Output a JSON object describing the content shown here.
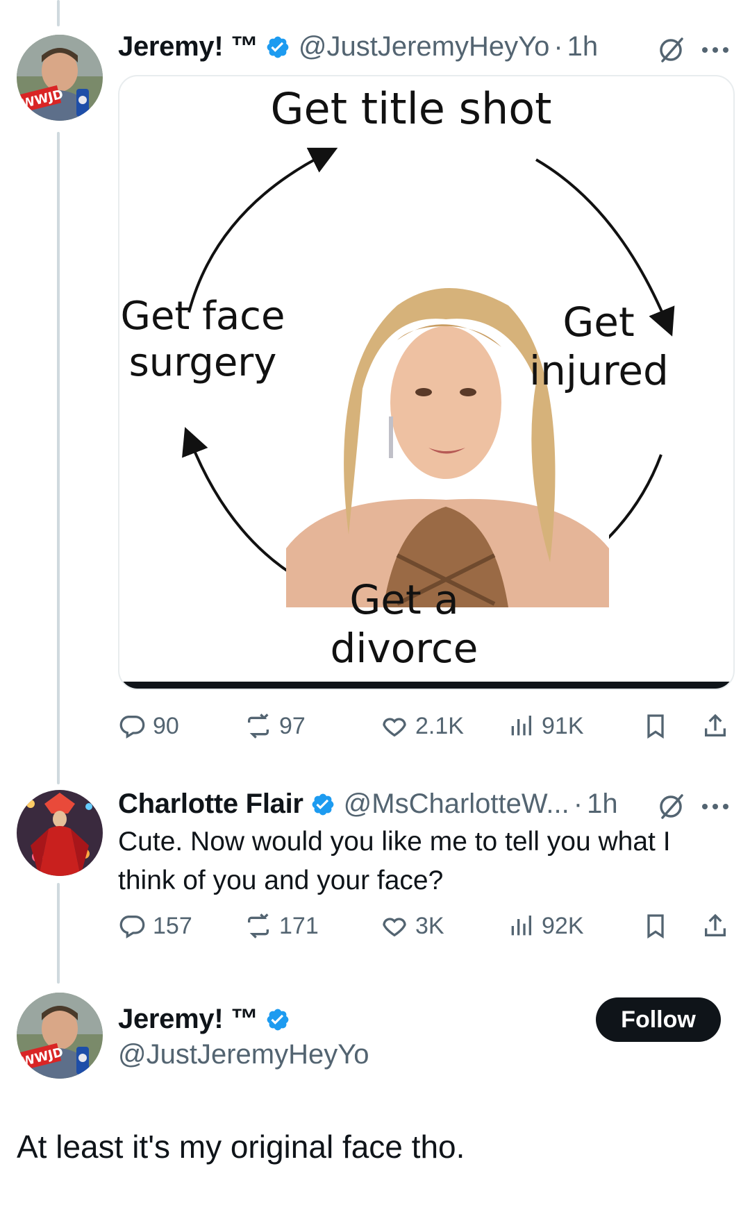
{
  "tweet1": {
    "name": "Jeremy! ™",
    "handle": "@JustJeremyHeyYo",
    "separator": "·",
    "time": "1h",
    "meme": {
      "top": "Get title shot",
      "right_line1": "Get",
      "right_line2": "injured",
      "bottom_line1": "Get a",
      "bottom_line2": "divorce",
      "left_line1": "Get face",
      "left_line2": "surgery"
    },
    "stats": {
      "replies": "90",
      "reposts": "97",
      "likes": "2.1K",
      "views": "91K"
    }
  },
  "tweet2": {
    "name": "Charlotte Flair",
    "handle": "@MsCharlotteW...",
    "separator": "·",
    "time": "1h",
    "text": "Cute. Now would you like me to tell you what I think of you and your face?",
    "stats": {
      "replies": "157",
      "reposts": "171",
      "likes": "3K",
      "views": "92K"
    }
  },
  "tweet3": {
    "name": "Jeremy! ™",
    "handle": "@JustJeremyHeyYo",
    "follow_label": "Follow",
    "text": "At least it's my original face tho."
  },
  "colors": {
    "verified": "#1d9bf0",
    "muted": "#536471",
    "text": "#0f1419",
    "thread_line": "#cfd9de",
    "follow_bg": "#0f1419"
  },
  "icons": [
    "verified-badge-icon",
    "grok-icon",
    "more-icon",
    "reply-icon",
    "repost-icon",
    "like-icon",
    "views-icon",
    "bookmark-icon",
    "share-icon"
  ]
}
